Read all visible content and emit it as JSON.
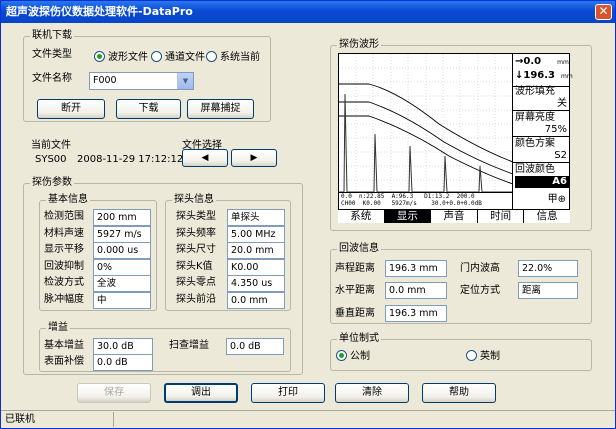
{
  "title": "超声波探伤仪数据处理软件-DataPro",
  "close_glyph": "✕",
  "conn": {
    "group": "联机下载",
    "file_type_label": "文件类型",
    "file_types": [
      "波形文件",
      "通道文件",
      "系统当前"
    ],
    "file_name_label": "文件名称",
    "file_name": "F000",
    "btn_disconnect": "断开",
    "btn_download": "下载",
    "btn_capture": "屏幕捕捉"
  },
  "current": {
    "label": "当前文件",
    "name": "SYS00",
    "date": "2008-11-29 17:12:12",
    "select_label": "文件选择",
    "prev": "◀",
    "next": "▶"
  },
  "params": {
    "group": "探伤参数",
    "basic": {
      "group": "基本信息",
      "rows": [
        {
          "label": "检测范围",
          "value": "200 mm"
        },
        {
          "label": "材料声速",
          "value": "5927 m/s"
        },
        {
          "label": "显示平移",
          "value": "0.000 us"
        },
        {
          "label": "回波抑制",
          "value": "0%"
        },
        {
          "label": "检波方式",
          "value": "全波"
        },
        {
          "label": "脉冲幅度",
          "value": "中"
        }
      ]
    },
    "probe": {
      "group": "探头信息",
      "rows": [
        {
          "label": "探头类型",
          "value": "单探头"
        },
        {
          "label": "探头频率",
          "value": "5.00 MHz"
        },
        {
          "label": "探头尺寸",
          "value": "20.0 mm"
        },
        {
          "label": "探头K值",
          "value": "K0.00"
        },
        {
          "label": "探头零点",
          "value": "4.350 us"
        },
        {
          "label": "探头前沿",
          "value": "0.0 mm"
        }
      ]
    },
    "gain": {
      "group": "增益",
      "base_label": "基本增益",
      "base_value": "30.0 dB",
      "scan_label": "扫查增益",
      "scan_value": "0.0 dB",
      "comp_label": "表面补偿",
      "comp_value": "0.0 dB"
    }
  },
  "scope": {
    "group": "探伤波形",
    "arrow": "→0.0",
    "arrow_unit": "mm",
    "down": "↓196.3",
    "down_unit": "mm",
    "opts": [
      {
        "label": "波形填充",
        "value": "关"
      },
      {
        "label": "屏幕亮度",
        "value": "75%"
      },
      {
        "label": "颜色方案",
        "value": "S2"
      },
      {
        "label": "回波颜色",
        "value": "A6"
      }
    ],
    "channel": "甲⊕",
    "bottom1": "0.0  n:22.85  A:96.3   D1:13.2  200.0",
    "bottom2": "CH00  K0.00   5927m/s    30.0+0.0+0.0dB",
    "menu": [
      "系统",
      "显示",
      "声音",
      "时间",
      "信息"
    ]
  },
  "echo": {
    "group": "回波信息",
    "sound_label": "声程距离",
    "sound_value": "196.3 mm",
    "gate_label": "门内波高",
    "gate_value": "22.0%",
    "horiz_label": "水平距离",
    "horiz_value": "0.0 mm",
    "locate_label": "定位方式",
    "locate_value": "距离",
    "vert_label": "垂直距离",
    "vert_value": "196.3 mm"
  },
  "unit": {
    "group": "单位制式",
    "metric": "公制",
    "imperial": "英制"
  },
  "buttons": {
    "save": "保存",
    "recall": "调出",
    "print": "打印",
    "clear": "清除",
    "help": "帮助"
  },
  "status": "已联机"
}
